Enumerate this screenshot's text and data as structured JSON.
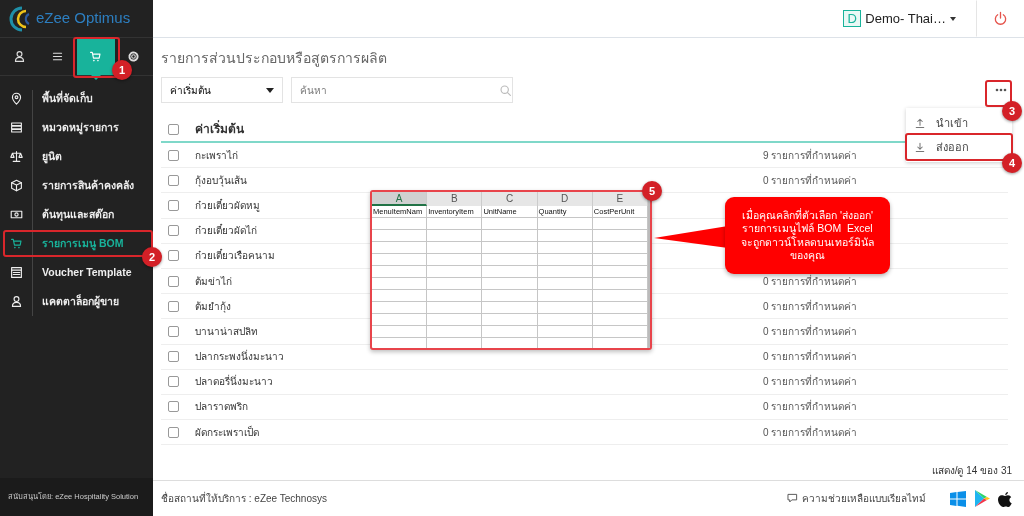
{
  "app": {
    "name": "eZee Optimus"
  },
  "sidebar": {
    "tabs": [
      {
        "selected": false
      },
      {
        "selected": false
      },
      {
        "selected": true
      },
      {
        "selected": false
      }
    ],
    "items": [
      {
        "label": "พื้นที่จัดเก็บ",
        "selected": false
      },
      {
        "label": "หมวดหมู่รายการ",
        "selected": false
      },
      {
        "label": "ยูนิต",
        "selected": false
      },
      {
        "label": "รายการสินค้าคงคลัง",
        "selected": false
      },
      {
        "label": "ต้นทุนและสต๊อก",
        "selected": false
      },
      {
        "label": "รายการเมนู BOM",
        "selected": true
      },
      {
        "label": "Voucher Template",
        "selected": false
      },
      {
        "label": "แคตตาล็อกผู้ขาย",
        "selected": false
      }
    ],
    "footer": "สนับสนุนโดย: eZee Hospitality Solution"
  },
  "topbar": {
    "property_initial": "D",
    "property_name": "Demo- Thai…"
  },
  "page": {
    "title": "รายการส่วนประกอบหรือสูตรการผลิต",
    "filter": "ค่าเริ่มต้น",
    "search": {
      "placeholder": "ค้นหา"
    },
    "more_menu": [
      {
        "label": "นำเข้า",
        "kind": "import"
      },
      {
        "label": "ส่งออก",
        "kind": "export"
      }
    ],
    "table": {
      "header": "ค่าเริ่มต้น",
      "header_checked": false,
      "rows": [
        {
          "name": "กะเพราไก่",
          "count": "9 รายการที่กำหนดค่า",
          "checked": false
        },
        {
          "name": "กุ้งอบวุ้นเส้น",
          "count": "0 รายการที่กำหนดค่า",
          "checked": false
        },
        {
          "name": "ก๋วยเตี๋ยวผัดหมู",
          "checked": false
        },
        {
          "name": "ก๋วยเตี๋ยวผัดไก่",
          "checked": false
        },
        {
          "name": "ก๋วยเตี๋ยวเรือคนาม",
          "checked": false
        },
        {
          "name": "ต้มข่าไก่",
          "count": "0 รายการที่กำหนดค่า",
          "checked": false
        },
        {
          "name": "ต้มยำกุ้ง",
          "count": "0 รายการที่กำหนดค่า",
          "checked": false
        },
        {
          "name": "บานาน่าสปลิท",
          "count": "0 รายการที่กำหนดค่า",
          "checked": false
        },
        {
          "name": "ปลากระพงนึ่งมะนาว",
          "count": "0 รายการที่กำหนดค่า",
          "checked": false
        },
        {
          "name": "ปลาดอรี่นึ่งมะนาว",
          "count": "0 รายการที่กำหนดค่า",
          "checked": false
        },
        {
          "name": "ปลาราดพริก",
          "count": "0 รายการที่กำหนดค่า",
          "checked": false
        },
        {
          "name": "ผัดกระเพราเป็ด",
          "count": "0 รายการที่กำหนดค่า",
          "checked": false
        }
      ]
    },
    "pager": "แสดง/ดู 14 ของ 31"
  },
  "footer": {
    "provider": "ชื่อสถานที่ให้บริการ : eZee Technosys",
    "help": "ความช่วยเหลือแบบเรียลไทม์"
  },
  "spreadsheet": {
    "columns": [
      {
        "letter": "A",
        "heading": "MenuItemNam",
        "selected": true
      },
      {
        "letter": "B",
        "heading": "InventoryItem",
        "selected": false
      },
      {
        "letter": "C",
        "heading": "UnitName",
        "selected": false
      },
      {
        "letter": "D",
        "heading": "Quantity",
        "selected": false
      },
      {
        "letter": "E",
        "heading": "CostPerUnit",
        "selected": false
      }
    ]
  },
  "callout": {
    "lines": [
      "เมื่อคุณคลิกที่ตัวเลือก 'ส่งออก'",
      "รายการเมนูไฟล์ BOM  Excel",
      "จะถูกดาวน์โหลดบนเทอร์มินัล",
      "ของคุณ"
    ]
  },
  "annotations": [
    {
      "number": "1"
    },
    {
      "number": "2"
    },
    {
      "number": "3"
    },
    {
      "number": "4"
    },
    {
      "number": "5"
    }
  ]
}
